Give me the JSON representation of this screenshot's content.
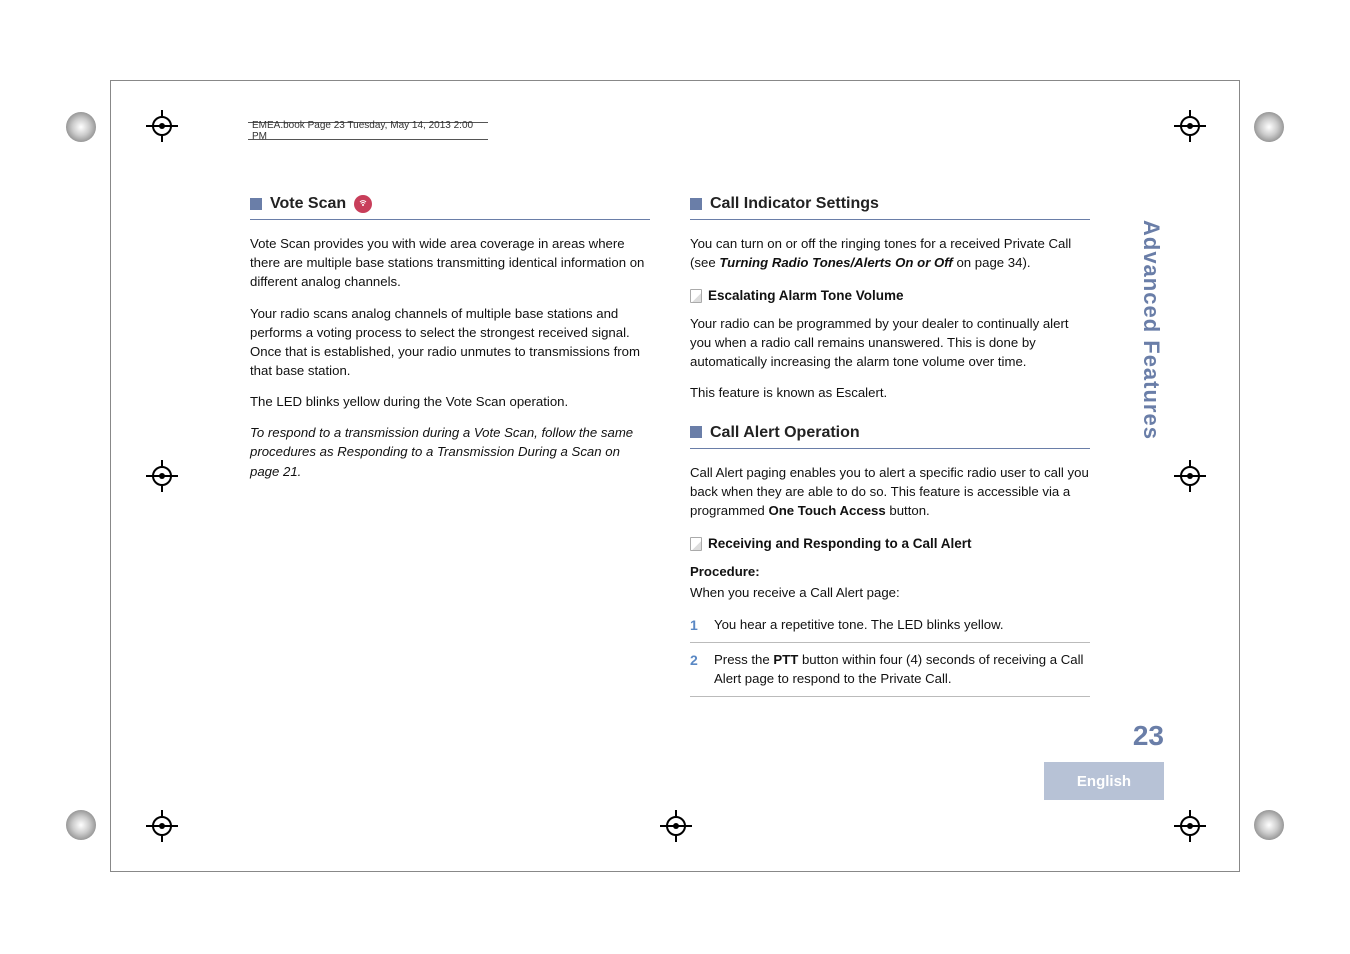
{
  "header": {
    "runhead": "EMEA.book  Page 23  Tuesday, May 14, 2013  2:00 PM"
  },
  "side": {
    "section": "Advanced Features",
    "page": "23",
    "language": "English"
  },
  "left": {
    "h1": "Vote Scan",
    "p1": "Vote Scan provides you with wide area coverage in areas where there are multiple base stations transmitting identical information on different analog channels.",
    "p2": "Your radio scans analog channels of multiple base stations and performs a voting process to select the strongest received signal. Once that is established, your radio unmutes to transmissions from that base station.",
    "p3": "The LED blinks yellow during the Vote Scan operation.",
    "p4": "To respond to a transmission during a Vote Scan, follow the same procedures as Responding to a Transmission During a Scan on page 21."
  },
  "right": {
    "h1": "Call Indicator Settings",
    "p1a": "You can turn on or off the ringing tones for a received Private Call (see ",
    "p1b": "Turning Radio Tones/Alerts On or Off",
    "p1c": " on page 34).",
    "sub1": "Escalating Alarm Tone Volume",
    "p2": "Your radio can be programmed by your dealer to continually alert you when a radio call remains unanswered. This is done by automatically increasing the alarm tone volume over time.",
    "p3": "This feature is known as Escalert.",
    "h2": "Call Alert Operation",
    "p4a": "Call Alert paging enables you to alert a specific radio user to call you back when they are able to do so. This feature is accessible via a programmed ",
    "p4b": "One Touch Access",
    "p4c": " button.",
    "sub2": "Receiving and Responding to a Call Alert",
    "proc_label": "Procedure:",
    "proc_intro": "When you receive a Call Alert page:",
    "step1_num": "1",
    "step1": "You hear a repetitive tone. The LED blinks yellow.",
    "step2_num": "2",
    "step2a": "Press the ",
    "step2b": "PTT",
    "step2c": " button within four (4) seconds of receiving a Call Alert page to respond to the Private Call."
  }
}
